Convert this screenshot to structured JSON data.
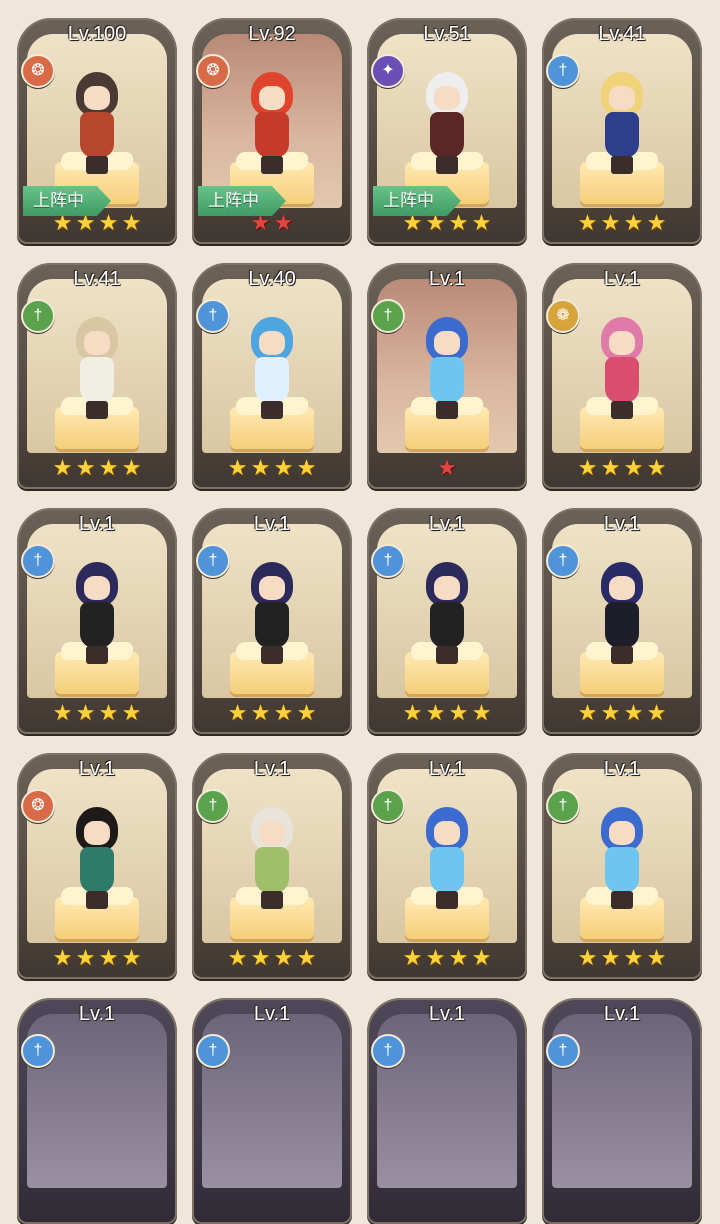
{
  "deploy_label": "上阵中",
  "colors": {
    "fire": "#d96a48",
    "ice": "#4f93d8",
    "nature": "#5aa24c",
    "dark": "#6a4fb4",
    "light": "#d6a43a"
  },
  "heroes": [
    {
      "level": "Lv.100",
      "class_icon": "wolf-icon",
      "class_color": "#d96a48",
      "stars": 4,
      "star_color": "gold",
      "deployed": true,
      "theme": "normal",
      "hair": "#4a3a36",
      "outfit": "#b8452e"
    },
    {
      "level": "Lv.92",
      "class_icon": "wolf-icon",
      "class_color": "#d96a48",
      "stars": 2,
      "star_color": "red",
      "deployed": true,
      "theme": "red",
      "hair": "#e0442c",
      "outfit": "#c53a2a"
    },
    {
      "level": "Lv.51",
      "class_icon": "void-icon",
      "class_color": "#6a4fb4",
      "stars": 4,
      "star_color": "gold",
      "deployed": true,
      "theme": "normal",
      "hair": "#eeeeee",
      "outfit": "#5a2626"
    },
    {
      "level": "Lv.41",
      "class_icon": "tree-icon",
      "class_color": "#4f93d8",
      "stars": 4,
      "star_color": "gold",
      "deployed": false,
      "theme": "normal",
      "hair": "#f0d278",
      "outfit": "#2d3f8c"
    },
    {
      "level": "Lv.41",
      "class_icon": "tree-icon",
      "class_color": "#5aa24c",
      "stars": 4,
      "star_color": "gold",
      "deployed": false,
      "theme": "normal",
      "hair": "#d8c7a2",
      "outfit": "#f1efe4"
    },
    {
      "level": "Lv.40",
      "class_icon": "tree-icon",
      "class_color": "#4f93d8",
      "stars": 4,
      "star_color": "gold",
      "deployed": false,
      "theme": "normal",
      "hair": "#4da6e0",
      "outfit": "#dff0ff"
    },
    {
      "level": "Lv.1",
      "class_icon": "tree-icon",
      "class_color": "#5aa24c",
      "stars": 1,
      "star_color": "red",
      "deployed": false,
      "theme": "red",
      "hair": "#3c6bd0",
      "outfit": "#6ec6f0"
    },
    {
      "level": "Lv.1",
      "class_icon": "wing-icon",
      "class_color": "#d6a43a",
      "stars": 4,
      "star_color": "gold",
      "deployed": false,
      "theme": "normal",
      "hair": "#e07aa8",
      "outfit": "#d94d6e"
    },
    {
      "level": "Lv.1",
      "class_icon": "tree-icon",
      "class_color": "#4f93d8",
      "stars": 4,
      "star_color": "gold",
      "deployed": false,
      "theme": "normal",
      "hair": "#2c2a5a",
      "outfit": "#222222"
    },
    {
      "level": "Lv.1",
      "class_icon": "tree-icon",
      "class_color": "#4f93d8",
      "stars": 4,
      "star_color": "gold",
      "deployed": false,
      "theme": "normal",
      "hair": "#2c2a5a",
      "outfit": "#222222"
    },
    {
      "level": "Lv.1",
      "class_icon": "tree-icon",
      "class_color": "#4f93d8",
      "stars": 4,
      "star_color": "gold",
      "deployed": false,
      "theme": "normal",
      "hair": "#2c2a5a",
      "outfit": "#222222"
    },
    {
      "level": "Lv.1",
      "class_icon": "tree-icon",
      "class_color": "#4f93d8",
      "stars": 4,
      "star_color": "gold",
      "deployed": false,
      "theme": "normal",
      "hair": "#2a2a66",
      "outfit": "#1e1e2a"
    },
    {
      "level": "Lv.1",
      "class_icon": "wolf-icon",
      "class_color": "#d96a48",
      "stars": 4,
      "star_color": "gold",
      "deployed": false,
      "theme": "normal",
      "hair": "#1e1a18",
      "outfit": "#2f7b6a"
    },
    {
      "level": "Lv.1",
      "class_icon": "tree-icon",
      "class_color": "#5aa24c",
      "stars": 4,
      "star_color": "gold",
      "deployed": false,
      "theme": "normal",
      "hair": "#e8e4dc",
      "outfit": "#9fbf6a"
    },
    {
      "level": "Lv.1",
      "class_icon": "tree-icon",
      "class_color": "#5aa24c",
      "stars": 4,
      "star_color": "gold",
      "deployed": false,
      "theme": "normal",
      "hair": "#3c6bd0",
      "outfit": "#6ec6f0"
    },
    {
      "level": "Lv.1",
      "class_icon": "tree-icon",
      "class_color": "#5aa24c",
      "stars": 4,
      "star_color": "gold",
      "deployed": false,
      "theme": "normal",
      "hair": "#3c6bd0",
      "outfit": "#6ec6f0"
    },
    {
      "level": "Lv.1",
      "class_icon": "tree-icon",
      "class_color": "#4f93d8",
      "stars": 0,
      "star_color": "gold",
      "deployed": false,
      "theme": "dark",
      "hair": "",
      "outfit": ""
    },
    {
      "level": "Lv.1",
      "class_icon": "tree-icon",
      "class_color": "#4f93d8",
      "stars": 0,
      "star_color": "gold",
      "deployed": false,
      "theme": "dark",
      "hair": "",
      "outfit": ""
    },
    {
      "level": "Lv.1",
      "class_icon": "tree-icon",
      "class_color": "#4f93d8",
      "stars": 0,
      "star_color": "gold",
      "deployed": false,
      "theme": "dark",
      "hair": "",
      "outfit": ""
    },
    {
      "level": "Lv.1",
      "class_icon": "tree-icon",
      "class_color": "#4f93d8",
      "stars": 0,
      "star_color": "gold",
      "deployed": false,
      "theme": "dark",
      "hair": "",
      "outfit": ""
    }
  ]
}
